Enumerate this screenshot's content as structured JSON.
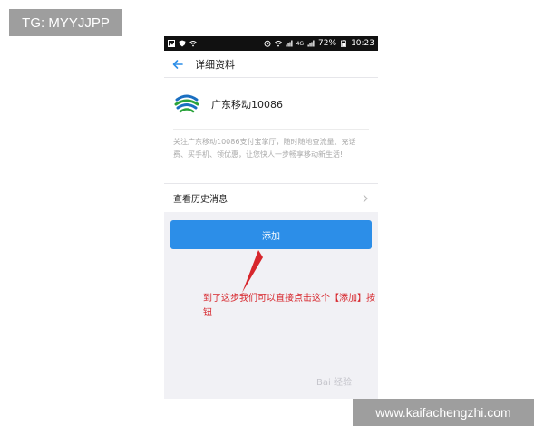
{
  "overlay": {
    "tg_label": "TG: MYYJJPP",
    "site_label": "www.kaifachengzhi.com"
  },
  "status_bar": {
    "battery": "72%",
    "time": "10:23",
    "network": "4G"
  },
  "nav": {
    "title": "详细资料",
    "back_icon": "back-arrow-icon"
  },
  "profile": {
    "name": "广东移动10086",
    "intro": "关注广东移动10086支付宝掌厅，随时随地查流量、充话费、买手机、领优惠，让您快人一步畅享移动新生活!"
  },
  "history": {
    "label": "查看历史消息"
  },
  "action": {
    "add_label": "添加"
  },
  "annotation": {
    "text": "到了这步我们可以直接点击这个【添加】按钮"
  },
  "watermark": {
    "text": "Bai 经验"
  },
  "colors": {
    "accent": "#2c8ee8",
    "annotation": "#d7262c",
    "logo_green": "#2aa33b",
    "logo_blue": "#1a6fc1"
  }
}
